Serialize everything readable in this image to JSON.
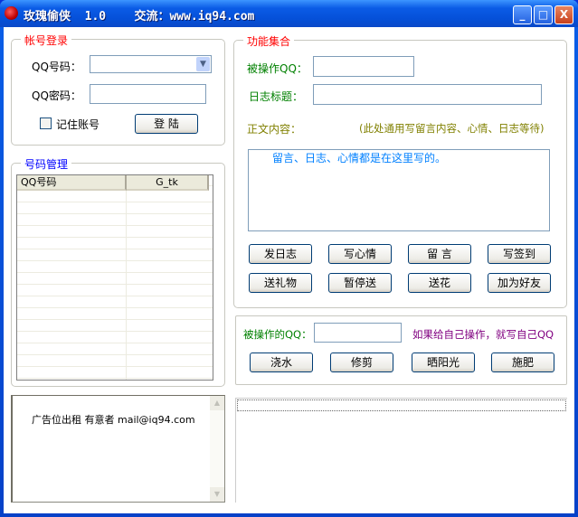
{
  "window": {
    "title": "玫瑰偷侠  1.0    交流：www.iq94.com",
    "min": "_",
    "max": "□",
    "close": "X"
  },
  "login": {
    "legend": "帐号登录",
    "qq_label": "QQ号码：",
    "qq_value": "",
    "pwd_label": "QQ密码：",
    "pwd_value": "",
    "remember": "记住账号",
    "login_btn": "登 陆"
  },
  "accounts": {
    "legend": "号码管理",
    "columns": [
      "QQ号码",
      "G_tk"
    ],
    "rows": []
  },
  "ad": {
    "text": "广告位出租 有意者 mail@iq94.com"
  },
  "functions": {
    "legend": "功能集合",
    "target_label": "被操作QQ：",
    "target_value": "",
    "title_label": "日志标题：",
    "title_value": "",
    "content_label": "正文内容：",
    "content_hint": "(此处通用写留言内容、心情、日志等待)",
    "content_value": "留言、日志、心情都是在这里写的。",
    "buttons": [
      "发日志",
      "写心情",
      "留 言",
      "写签到",
      "送礼物",
      "暂停送",
      "送花",
      "加为好友"
    ]
  },
  "garden": {
    "target_label": "被操作的QQ：",
    "target_value": "",
    "hint": "如果给自己操作，就写自己QQ",
    "buttons": [
      "浇水",
      "修剪",
      "晒阳光",
      "施肥"
    ]
  },
  "log": {
    "text": ""
  },
  "colors": {
    "legend_red": "#ff0000",
    "legend_blue": "#0000ff",
    "green": "#008000",
    "olive": "#808000",
    "purple": "#800080",
    "content_blue": "#0080ff"
  }
}
